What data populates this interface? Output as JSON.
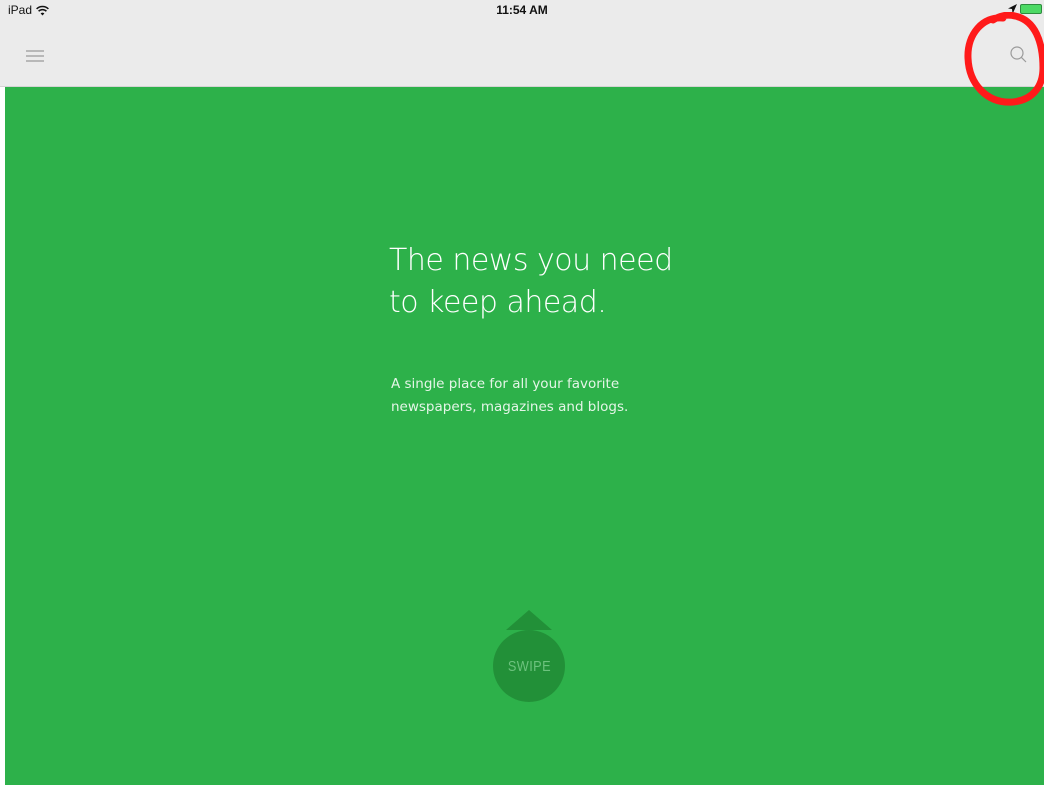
{
  "status_bar": {
    "device": "iPad",
    "time": "11:54 AM"
  },
  "nav": {
    "menu_icon": "hamburger-icon",
    "search_icon": "search-icon"
  },
  "hero": {
    "headline_line1": "The news you need",
    "headline_line2": "to keep ahead.",
    "sub_line1": "A single place for all your favorite",
    "sub_line2": "newspapers, magazines and blogs."
  },
  "swipe": {
    "label": "SWIPE"
  },
  "colors": {
    "brand_green": "#2db14a",
    "swipe_green": "#229038",
    "nav_bg": "#ebebeb",
    "annotation_red": "#ff1a1a"
  }
}
